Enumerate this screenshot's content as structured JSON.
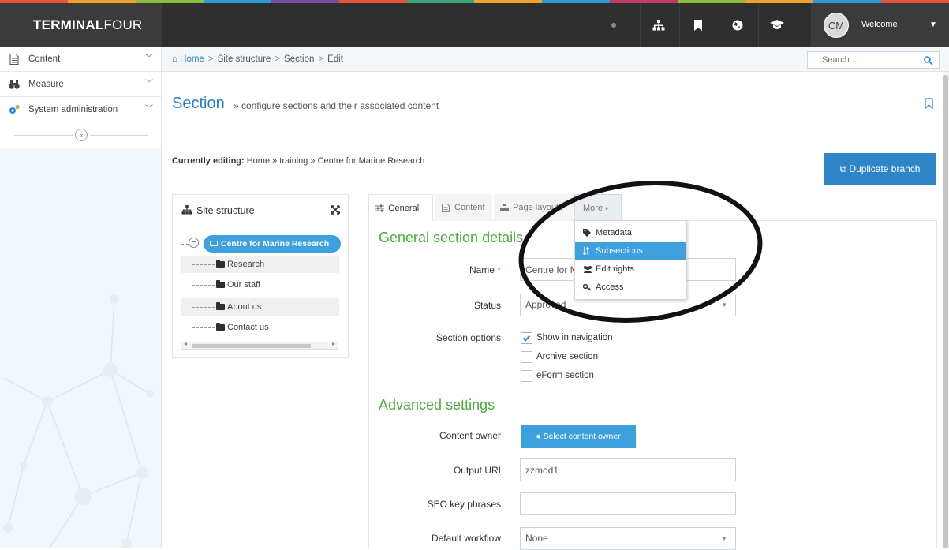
{
  "brand": {
    "bar_colors": [
      "#e6553b",
      "#f2a22b",
      "#8cbd3f",
      "#2f9bd6",
      "#7c4ea0",
      "#e6553b",
      "#3aa57a",
      "#f2a22b",
      "#2f9bd6",
      "#c6396b",
      "#8cbd3f",
      "#f2a22b",
      "#2f9bd6",
      "#e6553b"
    ],
    "logo_bold": "TERMINAL",
    "logo_light": "FOUR"
  },
  "topbar": {
    "avatar_initials": "CM",
    "welcome": "Welcome"
  },
  "sidebar": {
    "items": [
      {
        "label": "Content",
        "icon": "document-icon"
      },
      {
        "label": "Measure",
        "icon": "binoculars-icon"
      },
      {
        "label": "System administration",
        "icon": "gears-icon"
      }
    ],
    "collapse": "«"
  },
  "breadcrumb": {
    "home": "Home",
    "items": [
      "Site structure",
      "Section",
      "Edit"
    ],
    "separator": ">"
  },
  "search": {
    "placeholder": "Search ..."
  },
  "page": {
    "title": "Section",
    "subtitle": "» configure sections and their associated content",
    "editing_label": "Currently editing:",
    "editing_path": "Home » training » Centre for Marine Research",
    "duplicate_button": "Duplicate branch"
  },
  "tree": {
    "title": "Site structure",
    "root": "Centre for Marine Research",
    "children": [
      "Research",
      "Our staff",
      "About us",
      "Contact us"
    ]
  },
  "tabs": {
    "general": "General",
    "content": "Content",
    "layouts": "Page layouts",
    "more": "More"
  },
  "more_menu": {
    "items": [
      "Metadata",
      "Subsections",
      "Edit rights",
      "Access"
    ],
    "selected_index": 1
  },
  "form": {
    "general_heading": "General section details",
    "name_label": "Name",
    "name_required": "*",
    "name_value": "Centre for Marine Research",
    "status_label": "Status",
    "status_value": "Approved",
    "options_label": "Section options",
    "options": [
      {
        "label": "Show in navigation",
        "checked": true
      },
      {
        "label": "Archive section",
        "checked": false
      },
      {
        "label": "eForm section",
        "checked": false
      }
    ],
    "advanced_heading": "Advanced settings",
    "owner_label": "Content owner",
    "owner_button": "Select content owner",
    "output_uri_label": "Output URI",
    "output_uri_value": "zzmod1",
    "seo_label": "SEO key phrases",
    "seo_value": "",
    "workflow_label": "Default workflow",
    "workflow_value": "None"
  },
  "colors": {
    "accent": "#2e7fc2",
    "button_blue": "#3ea0dd",
    "heading_green": "#4caa3e",
    "topbar": "#2f2f2f"
  }
}
